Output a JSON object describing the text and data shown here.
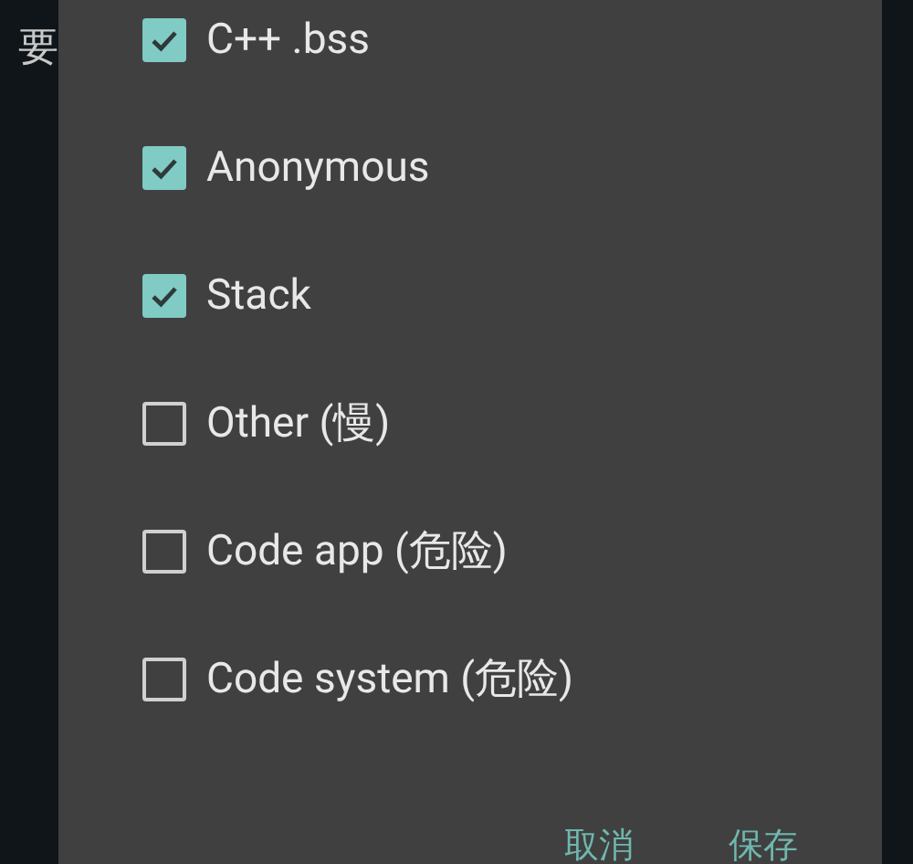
{
  "background_text": [
    "要"
  ],
  "options": [
    {
      "label": "C++ .bss",
      "checked": true
    },
    {
      "label": "Anonymous",
      "checked": true
    },
    {
      "label": "Stack",
      "checked": true
    },
    {
      "label": "Other (慢)",
      "checked": false
    },
    {
      "label": "Code app (危险)",
      "checked": false
    },
    {
      "label": "Code system (危险)",
      "checked": false
    }
  ],
  "buttons": [
    "取消",
    "保存"
  ]
}
